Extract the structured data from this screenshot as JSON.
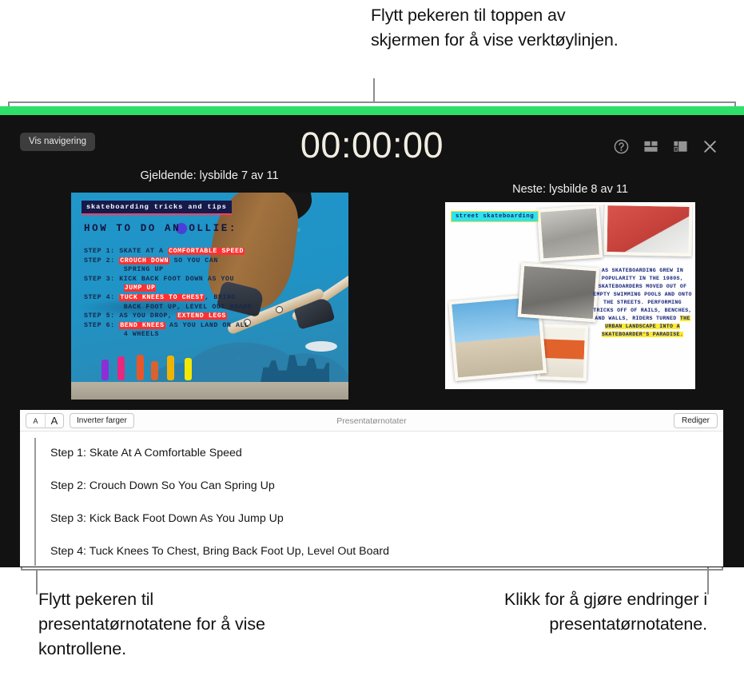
{
  "callouts": {
    "top": "Flytt pekeren til toppen av skjermen for å vise verktøylinjen.",
    "bottom_left": "Flytt pekeren til presentatørnotatene for å vise kontrollene.",
    "bottom_right": "Klikk for å gjøre endringer i presentatørnotatene."
  },
  "toolbar": {
    "nav_button": "Vis navigering",
    "timer": "00:00:00",
    "icons": [
      "help-icon",
      "layout-grid-icon",
      "layout-alt-icon",
      "close-icon"
    ]
  },
  "slides": {
    "current_label": "Gjeldende: lysbilde 7 av 11",
    "next_label": "Neste: lysbilde 8 av 11",
    "current": {
      "title": "skateboarding tricks and tips",
      "heading": "HOW TO DO AN OLLIE:",
      "steps": [
        {
          "label": "STEP 1:",
          "plain_before": "SKATE AT A ",
          "highlight": "COMFORTABLE SPEED",
          "plain_after": ""
        },
        {
          "label": "STEP 2:",
          "plain_before": "",
          "highlight": "CROUCH DOWN",
          "plain_after": " SO YOU CAN"
        },
        {
          "label": "",
          "plain_before": "SPRING UP",
          "highlight": "",
          "plain_after": ""
        },
        {
          "label": "STEP 3:",
          "plain_before": "KICK BACK FOOT DOWN AS YOU",
          "highlight": "",
          "plain_after": ""
        },
        {
          "label": "",
          "plain_before": "",
          "highlight": "JUMP UP",
          "plain_after": ""
        },
        {
          "label": "STEP 4:",
          "plain_before": "",
          "highlight": "TUCK KNEES TO CHEST",
          "plain_after": ", BRING"
        },
        {
          "label": "",
          "plain_before": "BACK FOOT UP, LEVEL OUT BOARD",
          "highlight": "",
          "plain_after": ""
        },
        {
          "label": "STEP 5:",
          "plain_before": "AS YOU DROP, ",
          "highlight": "EXTEND LEGS",
          "plain_after": ""
        },
        {
          "label": "STEP 6:",
          "plain_before": "",
          "highlight": "BEND KNEES",
          "plain_after": " AS YOU LAND ON ALL"
        },
        {
          "label": "",
          "plain_before": "4 WHEELS",
          "highlight": "",
          "plain_after": ""
        }
      ]
    },
    "next": {
      "title": "street skateboarding",
      "body_plain": "AS SKATEBOARDING GREW IN POPULARITY IN THE 1980S, SKATEBOARDERS MOVED OUT OF EMPTY SWIMMING POOLS AND ONTO THE STREETS. PERFORMING TRICKS OFF OF RAILS, BENCHES, AND WALLS, RIDERS TURNED ",
      "body_highlight": "THE URBAN LANDSCAPE INTO A SKATEBOARDER'S PARADISE."
    }
  },
  "notes": {
    "title": "Presentatørnotater",
    "text_small": "A",
    "text_large": "A",
    "invert_button": "Inverter farger",
    "edit_button": "Rediger",
    "lines": [
      "Step 1: Skate At A Comfortable Speed",
      "Step 2: Crouch Down So You Can Spring Up",
      "Step 3: Kick Back Foot Down As You Jump Up",
      "Step 4: Tuck Knees To Chest, Bring Back Foot Up, Level Out Board"
    ]
  },
  "colors": {
    "accent_green": "#2ee06a",
    "display_bg": "#121212",
    "callout_line": "#8c8c8c"
  }
}
